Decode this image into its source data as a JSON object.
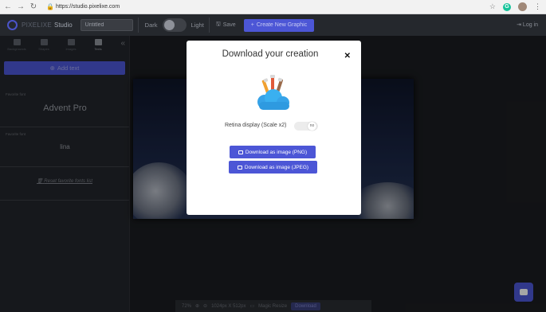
{
  "browser": {
    "url": "https://studio.pixelixe.com"
  },
  "topbar": {
    "brand": "PIXELIXE",
    "studio": "Studio",
    "title_value": "Untitled",
    "theme_dark": "Dark",
    "theme_light": "Light",
    "save_label": "Save",
    "create_label": "Create New Graphic",
    "login_label": "Log in"
  },
  "sidebar": {
    "tabs": [
      "Backgrounds",
      "Shapes",
      "Images",
      "Texts"
    ],
    "add_text_label": "Add text",
    "favorite_caption": "Favorite font",
    "fonts": [
      "Advent Pro",
      "lina"
    ],
    "reset_label": "Reset favorite fonts list"
  },
  "modal": {
    "title": "Download your creation",
    "retina_label": "Retina display (Scale x2)",
    "retina_toggle": "no",
    "png_label": "Download as image (PNG)",
    "jpeg_label": "Download as image (JPEG)"
  },
  "bottombar": {
    "zoom": "72%",
    "size": "1024px X 512px",
    "magic_resize": "Magic Resize",
    "download": "Download"
  },
  "colors": {
    "accent": "#4c56d6",
    "background": "#1b1d21"
  }
}
